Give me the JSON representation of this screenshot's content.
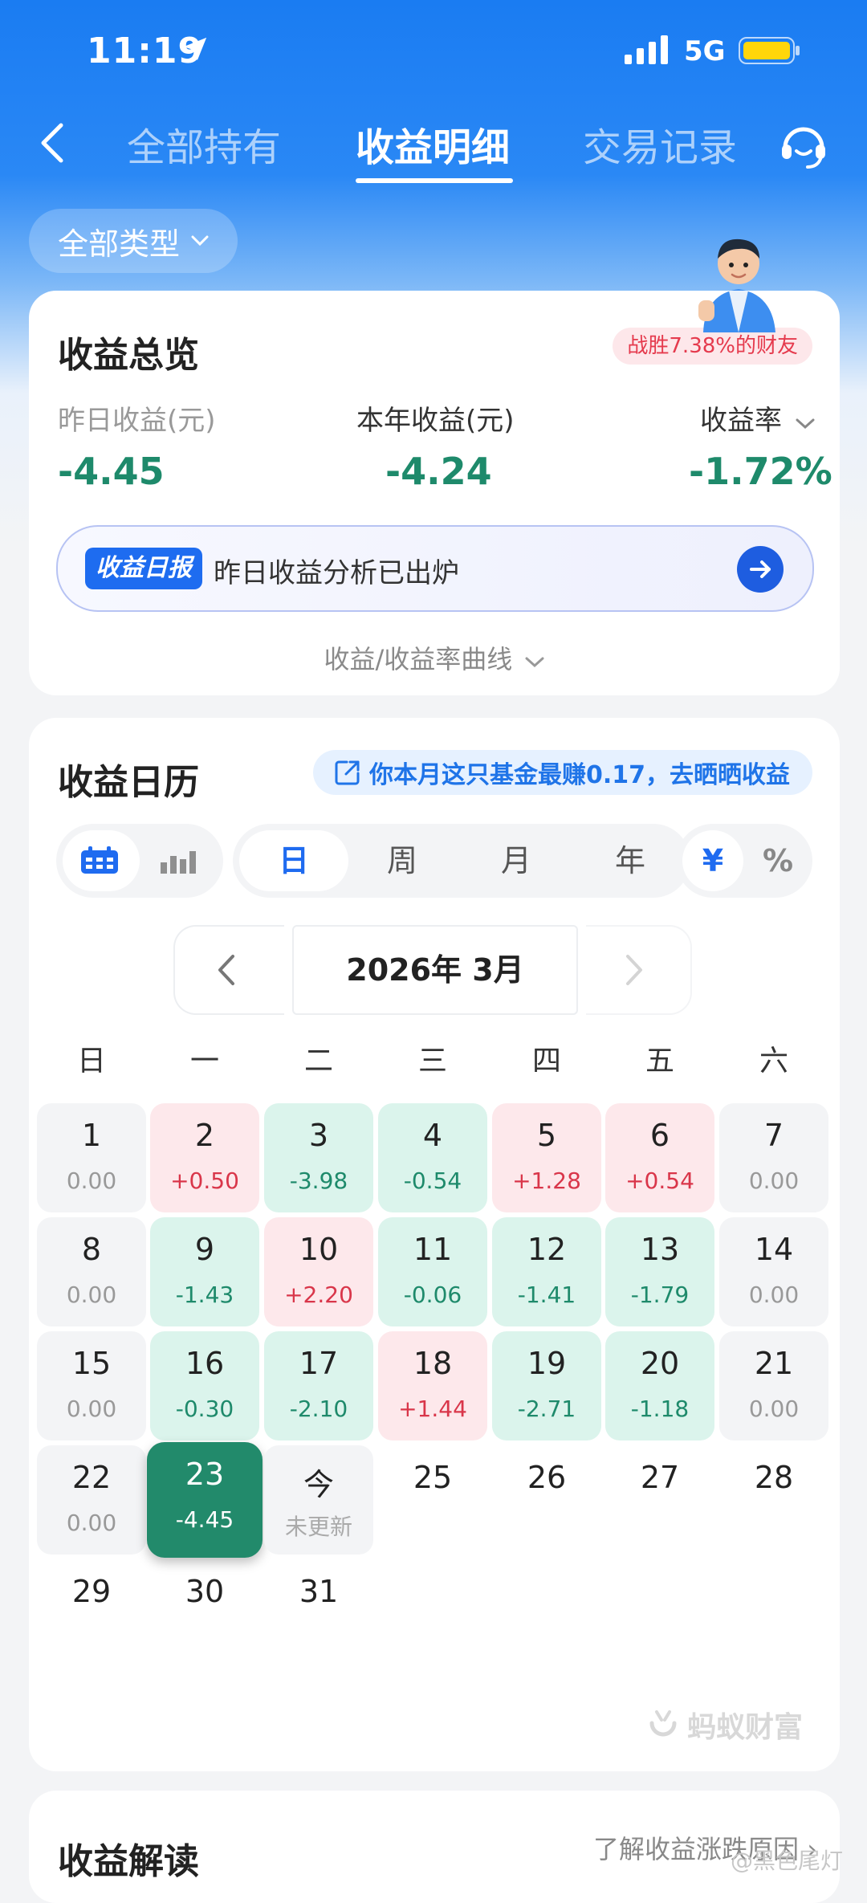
{
  "status": {
    "time": "11:19",
    "network": "5G"
  },
  "nav": {
    "tabs": [
      {
        "label": "全部持有"
      },
      {
        "label": "收益明细"
      },
      {
        "label": "交易记录"
      }
    ]
  },
  "filter": {
    "label": "全部类型"
  },
  "overview": {
    "title": "收益总览",
    "badge": "战胜7.38%的财友",
    "metrics": [
      {
        "label": "昨日收益(元)",
        "value": "-4.45"
      },
      {
        "label": "本年收益(元)",
        "value": "-4.24"
      },
      {
        "label": "收益率",
        "value": "-1.72%"
      }
    ],
    "report_tag": "收益日报",
    "report_text": "昨日收益分析已出炉",
    "curve_link": "收益/收益率曲线"
  },
  "calendar": {
    "title": "收益日历",
    "tip": "你本月这只基金最赚0.17，去晒晒收益",
    "periods": [
      "日",
      "周",
      "月",
      "年"
    ],
    "units": [
      "¥",
      "%"
    ],
    "month": "2026年 3月",
    "weekdays": [
      "日",
      "一",
      "二",
      "三",
      "四",
      "五",
      "六"
    ],
    "days": [
      {
        "day": "1",
        "value": "0.00"
      },
      {
        "day": "2",
        "value": "+0.50"
      },
      {
        "day": "3",
        "value": "-3.98"
      },
      {
        "day": "4",
        "value": "-0.54"
      },
      {
        "day": "5",
        "value": "+1.28"
      },
      {
        "day": "6",
        "value": "+0.54"
      },
      {
        "day": "7",
        "value": "0.00"
      },
      {
        "day": "8",
        "value": "0.00"
      },
      {
        "day": "9",
        "value": "-1.43"
      },
      {
        "day": "10",
        "value": "+2.20"
      },
      {
        "day": "11",
        "value": "-0.06"
      },
      {
        "day": "12",
        "value": "-1.41"
      },
      {
        "day": "13",
        "value": "-1.79"
      },
      {
        "day": "14",
        "value": "0.00"
      },
      {
        "day": "15",
        "value": "0.00"
      },
      {
        "day": "16",
        "value": "-0.30"
      },
      {
        "day": "17",
        "value": "-2.10"
      },
      {
        "day": "18",
        "value": "+1.44"
      },
      {
        "day": "19",
        "value": "-2.71"
      },
      {
        "day": "20",
        "value": "-1.18"
      },
      {
        "day": "21",
        "value": "0.00"
      },
      {
        "day": "22",
        "value": "0.00"
      },
      {
        "day": "23",
        "value": "-4.45"
      },
      {
        "day": "今",
        "value": "未更新"
      },
      {
        "day": "25",
        "value": ""
      },
      {
        "day": "26",
        "value": ""
      },
      {
        "day": "27",
        "value": ""
      },
      {
        "day": "28",
        "value": ""
      },
      {
        "day": "29",
        "value": ""
      },
      {
        "day": "30",
        "value": ""
      },
      {
        "day": "31",
        "value": ""
      }
    ],
    "brand": "蚂蚁财富"
  },
  "interpretation": {
    "title": "收益解读",
    "link": "了解收益涨跌原因"
  },
  "watermark": "@黑色尾灯",
  "colors": {
    "up": "#d9364a",
    "down": "#1e8a6b",
    "accent": "#1e6cf0"
  }
}
